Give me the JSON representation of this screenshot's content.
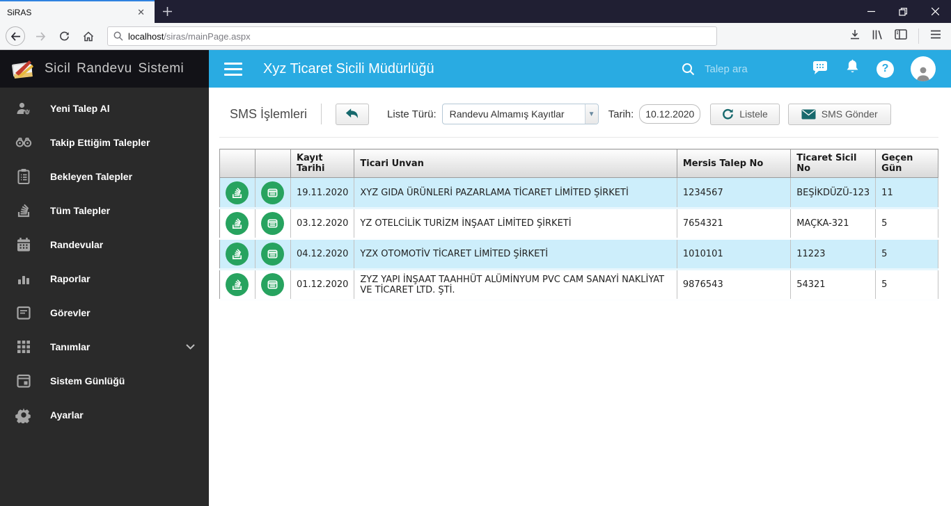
{
  "browser": {
    "tab_title": "SiRAS",
    "url_host": "localhost",
    "url_path": "/siras/mainPage.aspx"
  },
  "app": {
    "brand": "Sicil Randevu Sistemi",
    "header": {
      "title": "Xyz Ticaret Sicili Müdürlüğü",
      "search_placeholder": "Talep ara"
    },
    "sidebar": {
      "items": [
        {
          "label": "Yeni Talep Al",
          "icon": "user-gear-icon"
        },
        {
          "label": "Takip Ettiğim Talepler",
          "icon": "binoculars-icon"
        },
        {
          "label": "Bekleyen Talepler",
          "icon": "clipboard-icon"
        },
        {
          "label": "Tüm Talepler",
          "icon": "stack-icon"
        },
        {
          "label": "Randevular",
          "icon": "calendar-icon"
        },
        {
          "label": "Raporlar",
          "icon": "bar-chart-icon"
        },
        {
          "label": "Görevler",
          "icon": "task-calendar-icon"
        },
        {
          "label": "Tanımlar",
          "icon": "grid-icon",
          "has_submenu": true
        },
        {
          "label": "Sistem Günlüğü",
          "icon": "log-calendar-icon"
        },
        {
          "label": "Ayarlar",
          "icon": "gear-icon"
        }
      ]
    },
    "toolbar": {
      "page_title": "SMS İşlemleri",
      "liste_turu_label": "Liste Türü:",
      "liste_turu_value": "Randevu Almamış Kayıtlar",
      "tarih_label": "Tarih:",
      "tarih_value": "10.12.2020",
      "listele_label": "Listele",
      "sms_gonder_label": "SMS Gönder"
    },
    "table": {
      "headers": [
        "",
        "",
        "Kayıt Tarihi",
        "Ticari Unvan",
        "Mersis Talep No",
        "Ticaret Sicil No",
        "Geçen Gün"
      ],
      "rows": [
        {
          "kayit_tarihi": "19.11.2020",
          "ticari_unvan": "XYZ GIDA ÜRÜNLERİ PAZARLAMA TİCARET LİMİTED ŞİRKETİ",
          "mersis_talep_no": "1234567",
          "ticaret_sicil_no": "BEŞİKDÜZÜ-123",
          "gecen_gun": "11"
        },
        {
          "kayit_tarihi": "03.12.2020",
          "ticari_unvan": "YZ OTELCİLİK TURİZM İNŞAAT LİMİTED ŞİRKETİ",
          "mersis_talep_no": "7654321",
          "ticaret_sicil_no": "MAÇKA-321",
          "gecen_gun": "5"
        },
        {
          "kayit_tarihi": "04.12.2020",
          "ticari_unvan": "YZX OTOMOTİV TİCARET LİMİTED ŞİRKETİ",
          "mersis_talep_no": "1010101",
          "ticaret_sicil_no": "11223",
          "gecen_gun": "5"
        },
        {
          "kayit_tarihi": "01.12.2020",
          "ticari_unvan": "ZYZ YAPI İNŞAAT TAAHHÜT ALÜMİNYUM PVC CAM SANAYİ NAKLİYAT VE TİCARET LTD. ŞTİ.",
          "mersis_talep_no": "9876543",
          "ticaret_sicil_no": "54321",
          "gecen_gun": "5"
        }
      ]
    },
    "colors": {
      "appbar_blue": "#29abe2",
      "row_highlight_blue": "#cdeefb",
      "action_green": "#27a35f",
      "toolbar_icon_teal": "#17696d",
      "sidebar_dark": "#2a2a2a",
      "brand_bar_dark": "#121217"
    }
  }
}
